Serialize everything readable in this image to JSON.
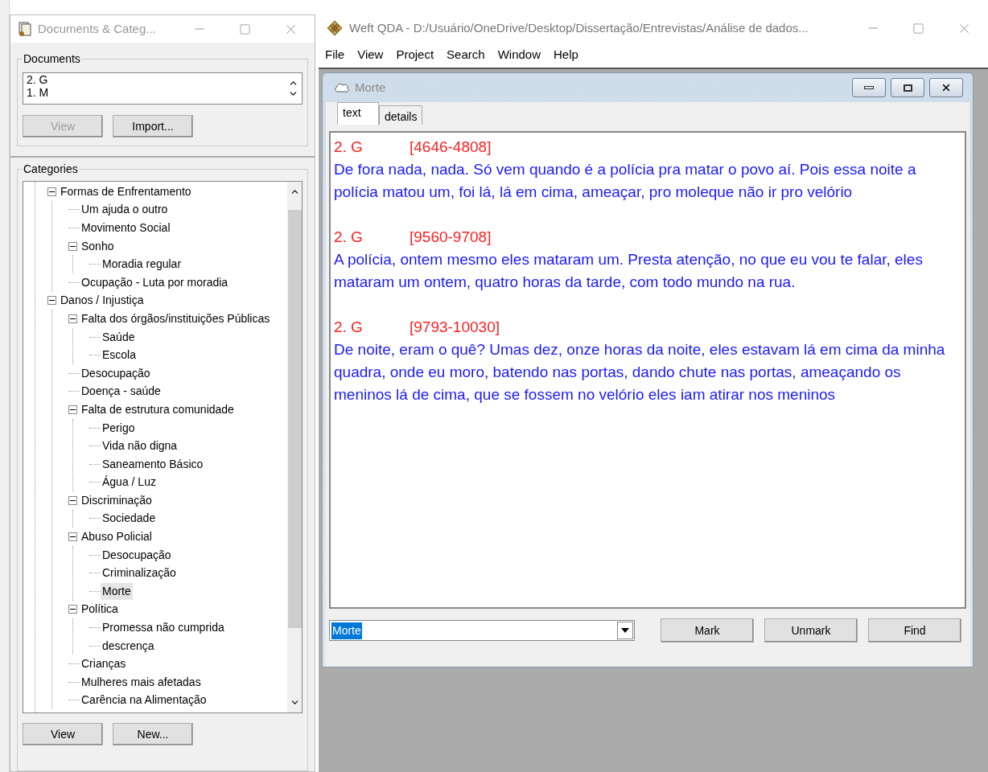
{
  "documents_window": {
    "title": "Documents & Categ...",
    "documents_group": {
      "label": "Documents",
      "items": [
        {
          "label": "2. G",
          "selected": false
        },
        {
          "label": "1. M",
          "selected": false
        }
      ],
      "buttons": [
        {
          "label": "View",
          "disabled": true
        },
        {
          "label": "Import...",
          "disabled": false
        }
      ]
    },
    "categories_group": {
      "label": "Categories",
      "tree": [
        {
          "label": "Formas de Enfrentamento",
          "expanded": true,
          "selected": false,
          "children": [
            {
              "label": "Um ajuda o outro",
              "selected": false
            },
            {
              "label": "Movimento Social",
              "selected": false
            },
            {
              "label": "Sonho",
              "expanded": true,
              "selected": false,
              "children": [
                {
                  "label": "Moradia regular",
                  "selected": false
                }
              ]
            },
            {
              "label": "Ocupação - Luta por moradia",
              "selected": false
            }
          ]
        },
        {
          "label": "Danos / Injustiça",
          "expanded": true,
          "selected": false,
          "children": [
            {
              "label": "Falta dos órgãos/instituições Públicas",
              "expanded": true,
              "selected": false,
              "children": [
                {
                  "label": "Saúde",
                  "selected": false
                },
                {
                  "label": "Escola",
                  "selected": false
                }
              ]
            },
            {
              "label": "Desocupação",
              "selected": false
            },
            {
              "label": "Doença - saúde",
              "selected": false
            },
            {
              "label": "Falta de estrutura comunidade",
              "expanded": true,
              "selected": false,
              "children": [
                {
                  "label": "Perigo",
                  "selected": false
                },
                {
                  "label": "Vida não digna",
                  "selected": false
                },
                {
                  "label": "Saneamento Básico",
                  "selected": false
                },
                {
                  "label": "Água / Luz",
                  "selected": false
                }
              ]
            },
            {
              "label": "Discriminação",
              "expanded": true,
              "selected": false,
              "children": [
                {
                  "label": "Sociedade",
                  "selected": false
                }
              ]
            },
            {
              "label": "Abuso Policial",
              "expanded": true,
              "selected": false,
              "children": [
                {
                  "label": "Desocupação",
                  "selected": false
                },
                {
                  "label": "Criminalização",
                  "selected": false
                },
                {
                  "label": "Morte",
                  "selected": true
                }
              ]
            },
            {
              "label": "Política",
              "expanded": true,
              "selected": false,
              "children": [
                {
                  "label": "Promessa não cumprida",
                  "selected": false
                },
                {
                  "label": "descrença",
                  "selected": false
                }
              ]
            },
            {
              "label": "Crianças",
              "selected": false
            },
            {
              "label": "Mulheres mais afetadas",
              "selected": false
            },
            {
              "label": "Carência na Alimentação",
              "selected": false
            }
          ]
        }
      ],
      "buttons": [
        {
          "label": "View",
          "disabled": false
        },
        {
          "label": "New...",
          "disabled": false
        }
      ]
    }
  },
  "main_window": {
    "title": "Weft QDA - D:/Usuário/OneDrive/Desktop/Dissertação/Entrevistas/Análise de dados...",
    "menu": [
      "File",
      "View",
      "Project",
      "Search",
      "Window",
      "Help"
    ],
    "child_window": {
      "title": "Morte",
      "tabs": [
        {
          "label": "text",
          "selected": true
        },
        {
          "label": "details",
          "selected": false
        }
      ],
      "passages": [
        {
          "document": "2. G",
          "range": "[4646-4808]",
          "text": "De fora nada, nada. Só vem quando é a polícia pra matar o povo aí. Pois essa noite a polícia matou um, foi lá, lá em cima, ameaçar, pro moleque não ir pro velório"
        },
        {
          "document": "2. G",
          "range": "[9560-9708]",
          "text": "A polícia, ontem mesmo eles mataram um. Presta atenção, no que eu vou te falar, eles mataram um ontem, quatro horas da tarde, com todo mundo na rua."
        },
        {
          "document": "2. G",
          "range": "[9793-10030]",
          "text": "De noite, eram o quê? Umas dez, onze horas da noite, eles estavam lá em cima da minha quadra, onde eu moro, batendo nas portas, dando chute nas portas, ameaçando os meninos lá de cima, que se fossem no velório eles iam atirar nos meninos"
        }
      ],
      "category_field": {
        "value": "Morte",
        "highlighted": true
      },
      "buttons": [
        "Mark",
        "Unmark",
        "Find"
      ]
    }
  }
}
